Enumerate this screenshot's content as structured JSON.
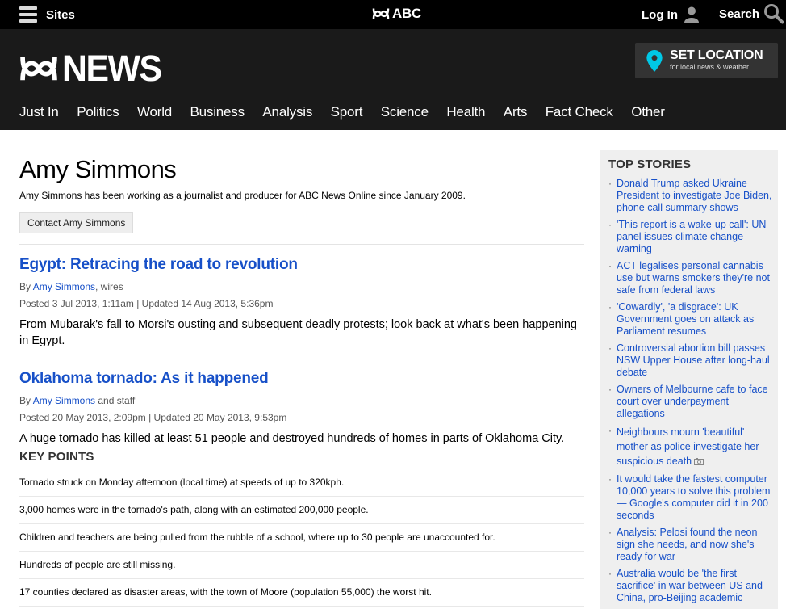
{
  "topbar": {
    "sites_label": "Sites",
    "brand": "ABC",
    "login_label": "Log In",
    "search_label": "Search"
  },
  "header": {
    "logo_word": "NEWS",
    "set_location": {
      "title": "SET LOCATION",
      "subtitle": "for local news & weather"
    },
    "nav": [
      "Just In",
      "Politics",
      "World",
      "Business",
      "Analysis",
      "Sport",
      "Science",
      "Health",
      "Arts",
      "Fact Check",
      "Other"
    ]
  },
  "author": {
    "name": "Amy Simmons",
    "bio": "Amy Simmons has been working as a journalist and producer for ABC News Online since January 2009.",
    "contact_label": "Contact Amy Simmons"
  },
  "articles": [
    {
      "title": "Egypt: Retracing the road to revolution",
      "by": "By",
      "author_link": "Amy Simmons",
      "by_suffix": ", wires",
      "posted": "Posted 3 Jul 2013, 1:11am | Updated 14 Aug 2013, 5:36pm",
      "summary": "From Mubarak's fall to Morsi's ousting and subsequent deadly protests; look back at what's been happening in Egypt."
    },
    {
      "title": "Oklahoma tornado: As it happened",
      "by": "By",
      "author_link": "Amy Simmons",
      "by_suffix": " and staff",
      "posted": "Posted 20 May 2013, 2:09pm | Updated 20 May 2013, 9:53pm",
      "summary": "A huge tornado has killed at least 51 people and destroyed hundreds of homes in parts of Oklahoma City.",
      "key_points_heading": "KEY POINTS",
      "key_points": [
        "Tornado struck on Monday afternoon (local time) at speeds of up to 320kph.",
        "3,000 homes were in the tornado's path, along with an estimated 200,000 people.",
        "Children and teachers are being pulled from the rubble of a school, where up to 30 people are unaccounted for.",
        "Hundreds of people are still missing.",
        "17 counties declared as disaster areas, with the town of Moore (population 55,000) the worst hit."
      ]
    }
  ],
  "sidebar": {
    "heading": "TOP STORIES",
    "stories": [
      "Donald Trump asked Ukraine President to investigate Joe Biden, phone call summary shows",
      "'This report is a wake-up call': UN panel issues climate change warning",
      "ACT legalises personal cannabis use but warns smokers they're not safe from federal laws",
      "'Cowardly', 'a disgrace': UK Government goes on attack as Parliament resumes",
      "Controversial abortion bill passes NSW Upper House after long-haul debate",
      "Owners of Melbourne cafe to face court over underpayment allegations",
      "Neighbours mourn 'beautiful' mother as police investigate her suspicious death",
      "It would take the fastest computer 10,000 years to solve this problem — Google's computer did it in 200 seconds",
      "Analysis: Pelosi found the neon sign she needs, and now she's ready for war",
      "Australia would be 'the first sacrifice' in war between US and China, pro-Beijing academic"
    ],
    "camera_icon_story": 6
  },
  "colors": {
    "link": "#1750c8",
    "topbar_bg": "#000000",
    "header_bg": "#1a1a1a",
    "pin": "#00c8e6",
    "sidebar_bg": "#efefef"
  },
  "icons": [
    "menu-icon",
    "abc-logo-icon",
    "user-icon",
    "search-icon",
    "location-pin-icon",
    "camera-icon"
  ]
}
